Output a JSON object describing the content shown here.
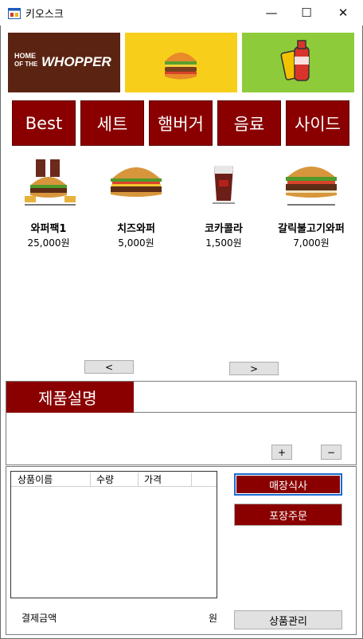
{
  "window": {
    "title": "키오스크",
    "minimize_icon": "—",
    "maximize_icon": "☐",
    "close_icon": "✕"
  },
  "banners": {
    "whopper_line1": "HOME",
    "whopper_line2": "OF THE",
    "whopper_word": "WHOPPER"
  },
  "categories": [
    "Best",
    "세트",
    "햄버거",
    "음료",
    "사이드"
  ],
  "products": [
    {
      "name": "와퍼팩1",
      "price": "25,000원"
    },
    {
      "name": "치즈와퍼",
      "price": "5,000원"
    },
    {
      "name": "코카콜라",
      "price": "1,500원"
    },
    {
      "name": "갈릭불고기와퍼",
      "price": "7,000원"
    }
  ],
  "nav": {
    "prev": "<",
    "next": ">"
  },
  "description": {
    "title": "제품설명",
    "plus": "+",
    "minus": "−"
  },
  "order": {
    "columns": [
      "상품이름",
      "수량",
      "가격"
    ],
    "dine_in": "매장식사",
    "takeout": "포장주문",
    "payment_label": "결제금액",
    "currency": "원",
    "manage": "상품관리"
  },
  "colors": {
    "accent": "#8a0000",
    "banner_brown": "#5b2412",
    "banner_yellow": "#f7cf1a",
    "banner_green": "#8ecb3a"
  }
}
